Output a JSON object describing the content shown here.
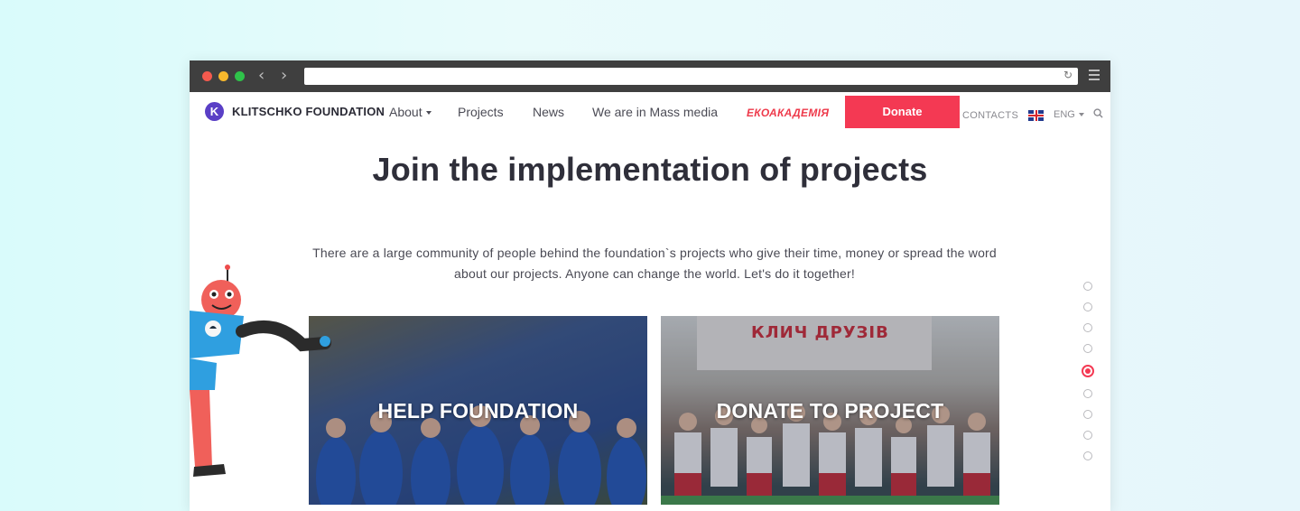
{
  "browser": {
    "back_label": "‹",
    "forward_label": "›"
  },
  "nav": {
    "logo_text": "KLITSCHKO FOUNDATION",
    "logo_mark": "K",
    "items": [
      {
        "label": "About"
      },
      {
        "label": "Projects"
      },
      {
        "label": "News"
      },
      {
        "label": "We are in Mass media"
      }
    ],
    "eko_label": "ЕКОАКАДЕМІЯ",
    "donate_label": "Donate",
    "contacts_label": "CONTACTS",
    "lang_label": "ENG"
  },
  "main": {
    "headline": "Join the implementation of projects",
    "intro_line1": "There are a large community of people behind the foundation`s projects who give their time, money or spread the word",
    "intro_line2": "about our projects. Anyone can change the world. Let's do it together!",
    "cards": [
      {
        "title": "HELP FOUNDATION"
      },
      {
        "title": "DONATE TO PROJECT",
        "banner_text": "КЛИЧ ДРУЗІВ"
      }
    ],
    "pager": {
      "count": 9,
      "active_index": 4
    }
  },
  "colors": {
    "accent": "#f43953",
    "brand": "#5a3fc6",
    "text_dark": "#2f2f3a"
  }
}
